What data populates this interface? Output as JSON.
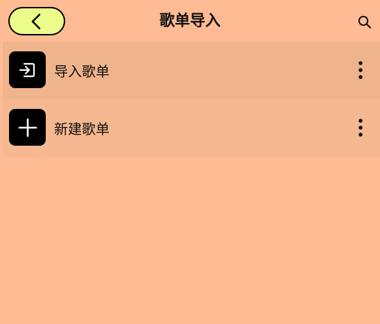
{
  "header": {
    "title": "歌单导入",
    "back_icon": "chevron-left-icon",
    "search_icon": "search-icon",
    "back_button_color": "#ECFC8A"
  },
  "colors": {
    "background": "#FFBB94",
    "selected_item": "#F0B48C",
    "item_background": "#F5B890",
    "icon_tile": "#000000"
  },
  "list": {
    "items": [
      {
        "label": "导入歌单",
        "icon": "import-icon",
        "more_icon": "more-vertical-icon",
        "selected": true
      },
      {
        "label": "新建歌单",
        "icon": "plus-icon",
        "more_icon": "more-vertical-icon",
        "selected": false
      }
    ]
  }
}
